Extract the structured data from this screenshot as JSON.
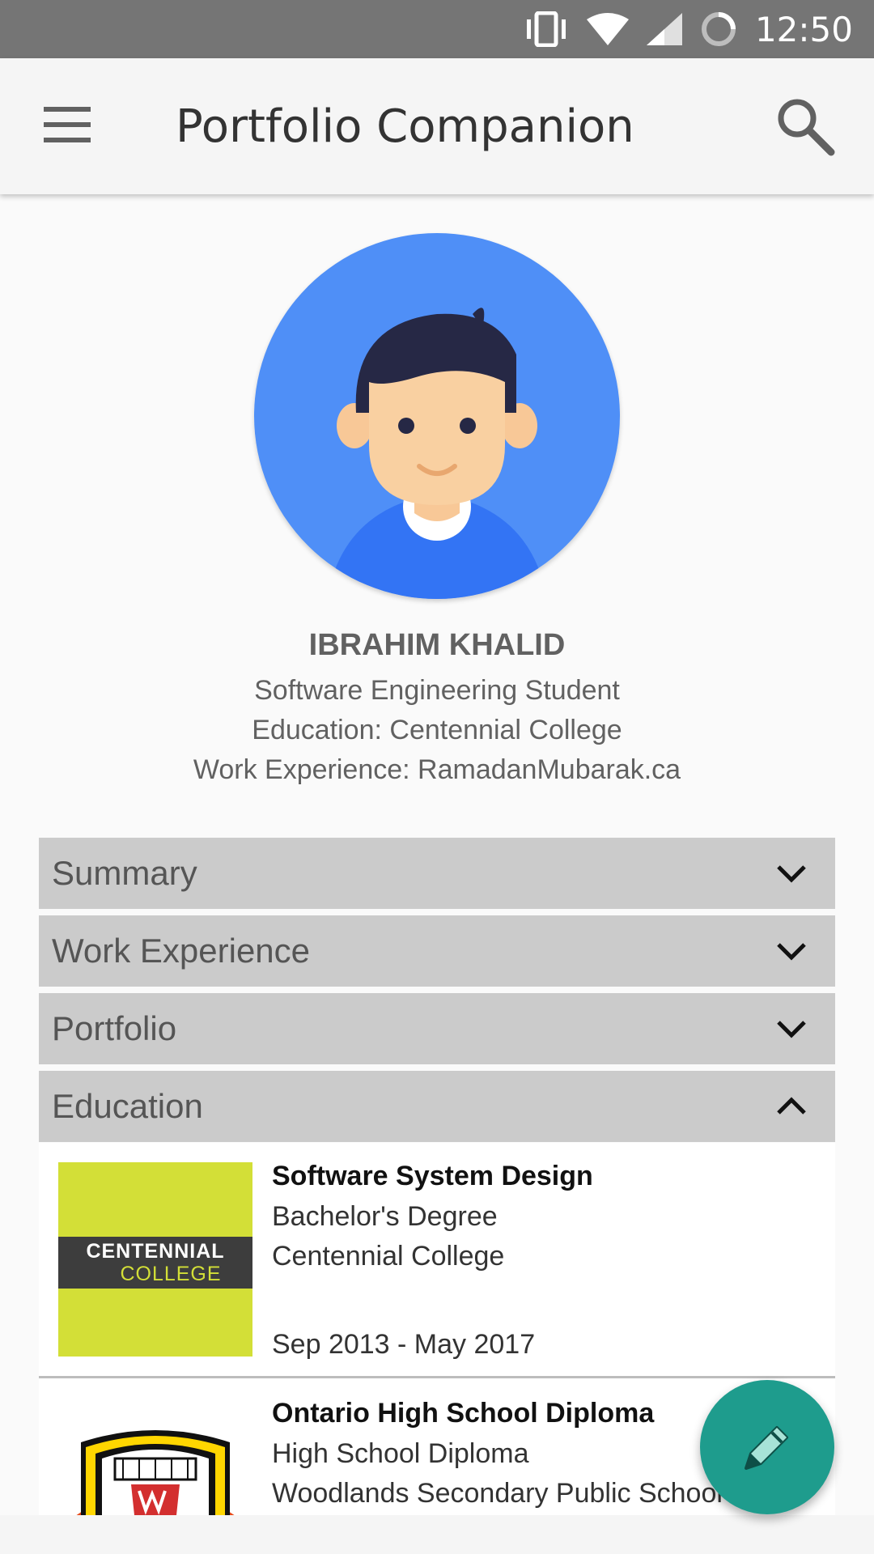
{
  "status_bar": {
    "time": "12:50"
  },
  "app_bar": {
    "title": "Portfolio Companion"
  },
  "profile": {
    "name": "IBRAHIM KHALID",
    "role": "Software Engineering Student",
    "education": "Education: Centennial College",
    "work": "Work Experience: RamadanMubarak.ca"
  },
  "sections": [
    {
      "label": "Summary",
      "expanded": false
    },
    {
      "label": "Work Experience",
      "expanded": false
    },
    {
      "label": "Portfolio",
      "expanded": false
    },
    {
      "label": "Education",
      "expanded": true
    }
  ],
  "education": [
    {
      "title": "Software System Design",
      "degree": "Bachelor's Degree",
      "school": "Centennial College",
      "dates": "Sep 2013 - May 2017",
      "logo_line1": "CENTENNIAL",
      "logo_line2": "COLLEGE"
    },
    {
      "title": "Ontario High School Diploma",
      "degree": "High School Diploma",
      "school": "Woodlands Secondary Public School"
    }
  ],
  "colors": {
    "status_bar": "#757575",
    "avatar_bg": "#4f8ff7",
    "section_header": "#cbcbcb",
    "fab": "#1e9c8d",
    "centennial_green": "#d3df37"
  },
  "icons": [
    "vibrate-icon",
    "wifi-icon",
    "signal-icon",
    "battery-icon",
    "menu-icon",
    "search-icon",
    "chevron-down-icon",
    "chevron-up-icon",
    "pencil-icon"
  ]
}
